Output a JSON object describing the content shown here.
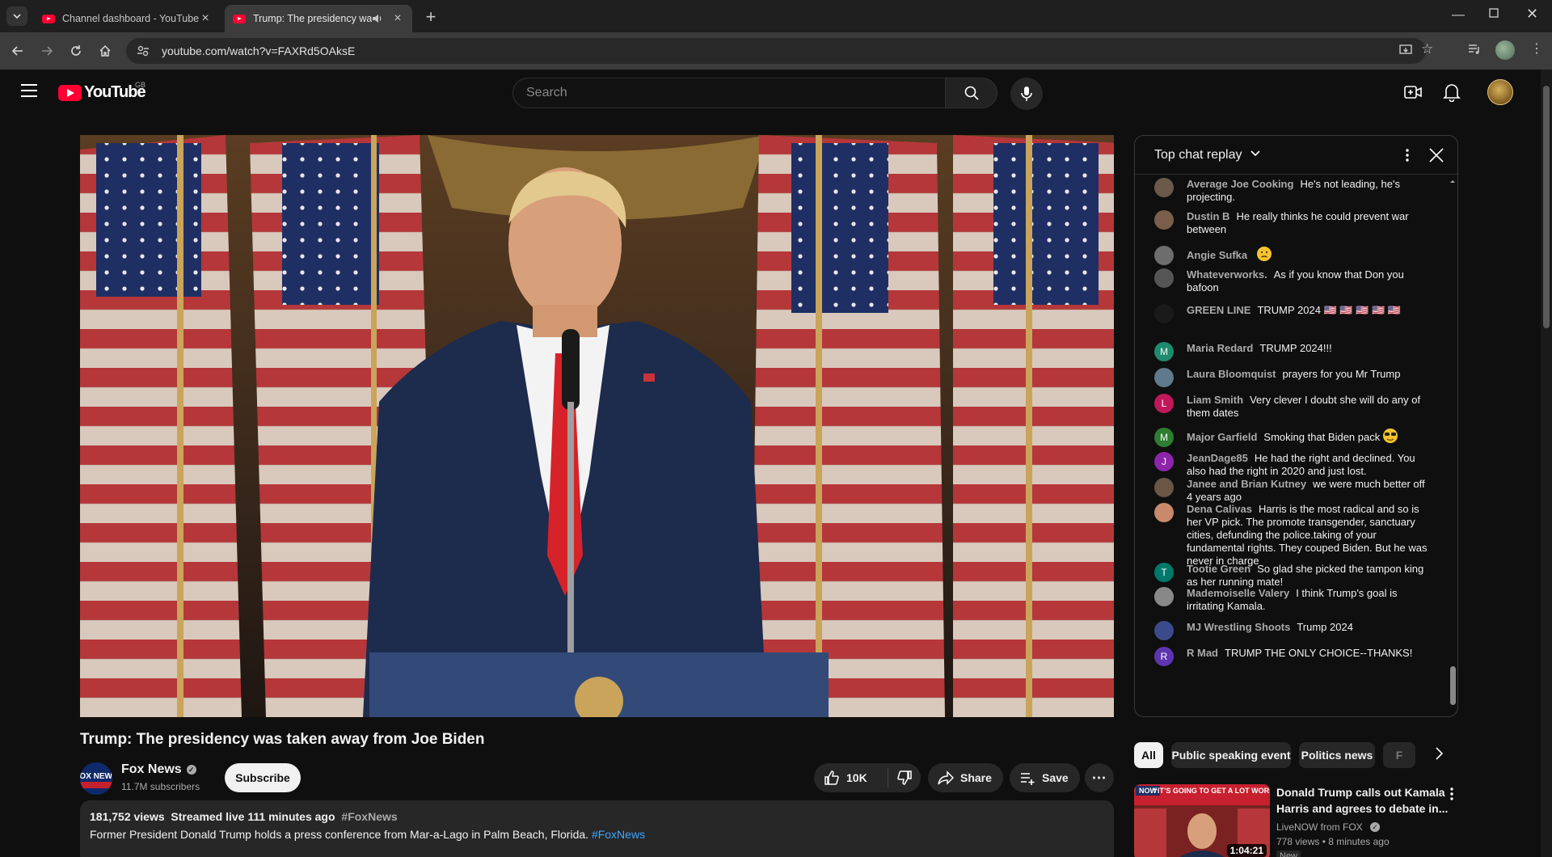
{
  "browser": {
    "tabs": [
      {
        "title": "Channel dashboard - YouTube"
      },
      {
        "title": "Trump: The presidency was"
      }
    ],
    "url": "youtube.com/watch?v=FAXRd5OAksE"
  },
  "masthead": {
    "logo_text": "YouTube",
    "country_code": "GB",
    "search_placeholder": "Search"
  },
  "video": {
    "title": "Trump: The presidency was taken away from Joe Biden",
    "channel": {
      "name": "Fox News",
      "subscribers": "11.7M subscribers",
      "subscribe_label": "Subscribe",
      "avatar_text": "FOX NEWS"
    },
    "actions": {
      "likes": "10K",
      "share": "Share",
      "save": "Save"
    },
    "description": {
      "views": "181,752 views",
      "streamed": "Streamed live 111 minutes ago",
      "tag": "#FoxNews",
      "text": "Former President Donald Trump holds a press conference from Mar-a-Lago in Palm Beach, Florida.",
      "hashtag": "#FoxNews"
    }
  },
  "chat": {
    "title": "Top chat replay",
    "messages": [
      {
        "author": "Average Joe Cooking",
        "text": "He's not leading, he's projecting.",
        "avatar": "",
        "color": "#6b5a4a"
      },
      {
        "author": "Dustin B",
        "text": "He really thinks he could prevent war between",
        "avatar": "",
        "color": "#7a5d4a"
      },
      {
        "author": "Angie Sufka",
        "text": "",
        "avatar": "",
        "color": "#6d6d6d",
        "emoji": "slight-frown"
      },
      {
        "author": "Whateverworks.",
        "text": "As if you know that Don you bafoon",
        "avatar": "",
        "color": "#555"
      },
      {
        "author": "GREEN LINE",
        "text": "TRUMP 2024 🇺🇸 🇺🇸 🇺🇸 🇺🇸 🇺🇸",
        "avatar": "",
        "color": "#1a1a1a"
      },
      {
        "author": "Maria Redard",
        "text": "TRUMP 2024!!!",
        "avatar": "M",
        "color": "#1e8a6e"
      },
      {
        "author": "Laura Bloomquist",
        "text": "prayers for you Mr Trump",
        "avatar": "",
        "color": "#5f7a8c"
      },
      {
        "author": "Liam Smith",
        "text": "Very clever I doubt she will do any of them dates",
        "avatar": "L",
        "color": "#c2185b"
      },
      {
        "author": "Major Garfield",
        "text": "Smoking that Biden pack",
        "avatar": "M",
        "color": "#2e7d32",
        "emoji": "sunglasses"
      },
      {
        "author": "JeanDage85",
        "text": "He had the right and declined. You also had the right in 2020 and just lost.",
        "avatar": "J",
        "color": "#8e24aa"
      },
      {
        "author": "Janee and Brian Kutney",
        "text": "we were much better off 4 years ago",
        "avatar": "",
        "color": "#6b5545"
      },
      {
        "author": "Dena Calivas",
        "text": "Harris is the most radical and so is her VP pick. The promote transgender, sanctuary cities, defunding the police.taking of your fundamental rights. They couped Biden. But he was never in charge",
        "avatar": "",
        "color": "#c88a6a"
      },
      {
        "author": "Tootie Green",
        "text": "So glad she picked the tampon king as her running mate!",
        "avatar": "T",
        "color": "#00796b"
      },
      {
        "author": "Mademoiselle Valery",
        "text": "I think Trump's goal is irritating Kamala.",
        "avatar": "",
        "color": "#888"
      },
      {
        "author": "MJ Wrestling Shoots",
        "text": "Trump 2024",
        "avatar": "",
        "color": "#3a4a8a"
      },
      {
        "author": "R Mad",
        "text": "TRUMP THE ONLY CHOICE--THANKS!",
        "avatar": "R",
        "color": "#5e35b1"
      }
    ]
  },
  "chips": [
    "All",
    "Public speaking event",
    "Politics news",
    "F"
  ],
  "recommendation": {
    "title": "Donald Trump calls out Kamala Harris and agrees to debate in...",
    "channel": "LiveNOW from FOX",
    "meta": "778 views • 8 minutes ago",
    "badge": "New",
    "duration": "1:04:21",
    "thumb_caption": "“IT’S GOING TO GET A LOT WORSE”",
    "thumb_logo": "NOW"
  }
}
